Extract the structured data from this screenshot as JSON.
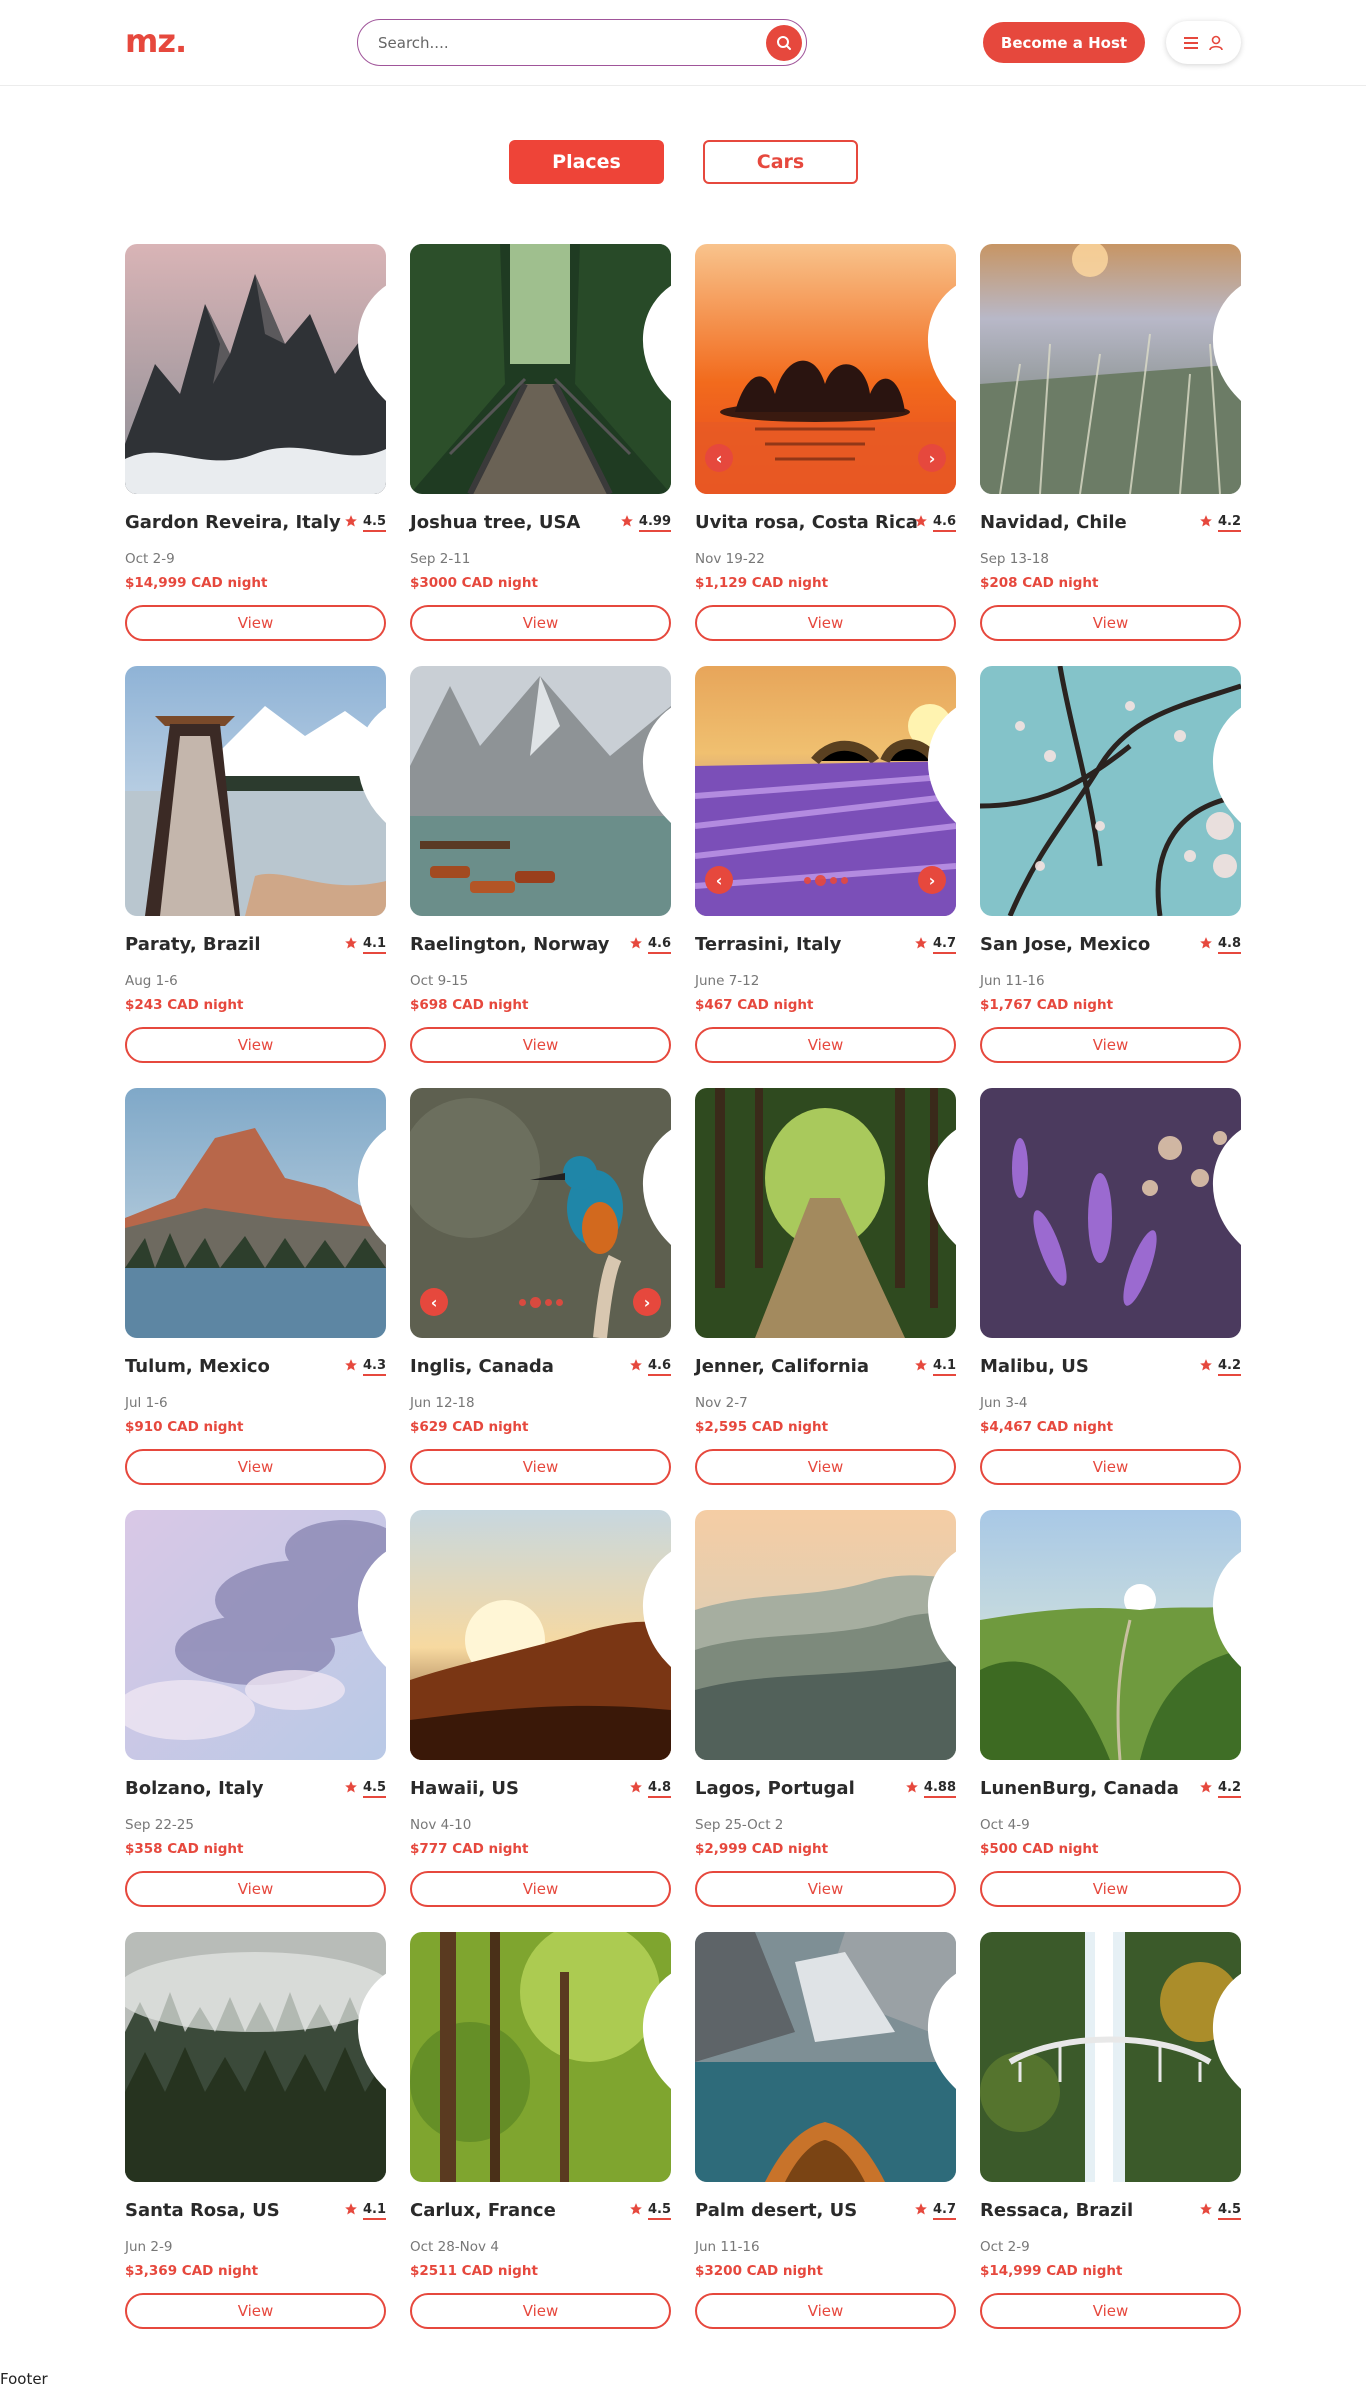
{
  "header": {
    "logo": "mz.",
    "search_placeholder": "Search....",
    "host_button": "Become a Host"
  },
  "tabs": [
    {
      "label": "Places",
      "active": true
    },
    {
      "label": "Cars",
      "active": false
    }
  ],
  "colors": {
    "accent": "#e6483d",
    "tab_active": "#ee4438"
  },
  "icons": {
    "search": "search-icon",
    "menu": "hamburger-menu-icon",
    "user": "user-icon",
    "favorite": "heart-icon",
    "rating": "star-icon",
    "prev": "chevron-left-icon",
    "next": "chevron-right-icon"
  },
  "listings": [
    {
      "title": "Gardon Reveira, Italy",
      "rating": "4.5",
      "dates": "Oct 2-9",
      "price": "$14,999 CAD night",
      "view": "View",
      "scene": "peaks"
    },
    {
      "title": "Joshua tree, USA",
      "rating": "4.99",
      "dates": "Sep 2-11",
      "price": "$3000 CAD night",
      "view": "View",
      "scene": "bridge"
    },
    {
      "title": "Uvita rosa, Costa Rica",
      "rating": "4.6",
      "dates": "Nov 19-22",
      "price": "$1,129 CAD night",
      "view": "View",
      "scene": "sunset-island",
      "arrows": true
    },
    {
      "title": "Navidad, Chile",
      "rating": "4.2",
      "dates": "Sep 13-18",
      "price": "$208 CAD night",
      "view": "View",
      "scene": "meadow"
    },
    {
      "title": "Paraty, Brazil",
      "rating": "4.1",
      "dates": "Aug 1-6",
      "price": "$243 CAD night",
      "view": "View",
      "scene": "lake-person"
    },
    {
      "title": "Raelington, Norway",
      "rating": "4.6",
      "dates": "Oct 9-15",
      "price": "$698 CAD night",
      "view": "View",
      "scene": "mountain-lake"
    },
    {
      "title": "Terrasini, Italy",
      "rating": "4.7",
      "dates": "June 7-12",
      "price": "$467 CAD night",
      "view": "View",
      "scene": "lavender-sunset",
      "arrows": true,
      "dots": 4
    },
    {
      "title": "San Jose, Mexico",
      "rating": "4.8",
      "dates": "Jun 11-16",
      "price": "$1,767 CAD night",
      "view": "View",
      "scene": "blossom"
    },
    {
      "title": "Tulum, Mexico",
      "rating": "4.3",
      "dates": "Jul 1-6",
      "price": "$910 CAD night",
      "view": "View",
      "scene": "dolomites"
    },
    {
      "title": "Inglis, Canada",
      "rating": "4.6",
      "dates": "Jun 12-18",
      "price": "$629 CAD night",
      "view": "View",
      "scene": "kingfisher",
      "arrows": true,
      "dots": 4
    },
    {
      "title": "Jenner, California",
      "rating": "4.1",
      "dates": "Nov 2-7",
      "price": "$2,595 CAD night",
      "view": "View",
      "scene": "forest-path"
    },
    {
      "title": "Malibu, US",
      "rating": "4.2",
      "dates": "Jun 3-4",
      "price": "$4,467 CAD night",
      "view": "View",
      "scene": "lavender-bokeh"
    },
    {
      "title": "Bolzano, Italy",
      "rating": "4.5",
      "dates": "Sep 22-25",
      "price": "$358 CAD night",
      "view": "View",
      "scene": "clouds"
    },
    {
      "title": "Hawaii, US",
      "rating": "4.8",
      "dates": "Nov 4-10",
      "price": "$777 CAD night",
      "view": "View",
      "scene": "sun-hills"
    },
    {
      "title": "Lagos, Portugal",
      "rating": "4.88",
      "dates": "Sep 25-Oct 2",
      "price": "$2,999 CAD night",
      "view": "View",
      "scene": "misty-hills"
    },
    {
      "title": "LunenBurg, Canada",
      "rating": "4.2",
      "dates": "Oct 4-9",
      "price": "$500 CAD night",
      "view": "View",
      "scene": "green-valley"
    },
    {
      "title": "Santa Rosa, US",
      "rating": "4.1",
      "dates": "Jun 2-9",
      "price": "$3,369 CAD night",
      "view": "View",
      "scene": "foggy-forest"
    },
    {
      "title": "Carlux, France",
      "rating": "4.5",
      "dates": "Oct 28-Nov 4",
      "price": "$2511 CAD night",
      "view": "View",
      "scene": "green-trees"
    },
    {
      "title": "Palm desert, US",
      "rating": "4.7",
      "dates": "Jun 11-16",
      "price": "$3200 CAD night",
      "view": "View",
      "scene": "boat-lake"
    },
    {
      "title": "Ressaca, Brazil",
      "rating": "4.5",
      "dates": "Oct 2-9",
      "price": "$14,999 CAD night",
      "view": "View",
      "scene": "waterfall"
    }
  ],
  "footer": "Footer"
}
